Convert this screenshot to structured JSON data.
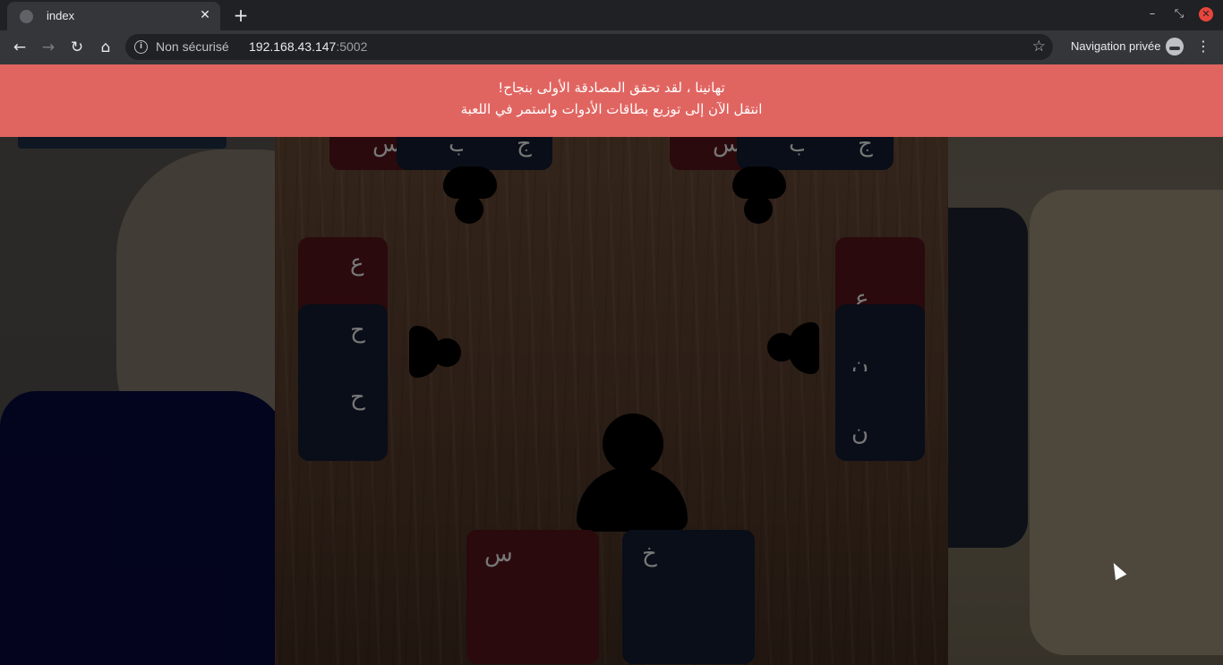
{
  "browser": {
    "tab_title": "index",
    "tab_close_icon": "✕",
    "new_tab_icon": "+",
    "security_label": "Non sécurisé",
    "url_host": "192.168.43.147",
    "url_port": ":5002",
    "incognito_label": "Navigation privée",
    "icons": {
      "back": "back-arrow-icon",
      "forward": "forward-arrow-icon",
      "reload": "reload-icon",
      "home": "home-icon",
      "info": "info-icon",
      "star": "star-icon",
      "incognito": "incognito-icon",
      "menu": "menu-icon"
    }
  },
  "toast": {
    "line1": "تهانينا ، لقد تحقق المصادقة الأولى بنجاح!",
    "line2": "انتقل الآن إلى توزيع بطاقات الأدوات واستمر في اللعبة",
    "color": "#e06561"
  },
  "game": {
    "top_left_hand": [
      "س",
      "ب",
      "ج"
    ],
    "top_right_hand": [
      "س",
      "ب",
      "ج"
    ],
    "left_hand": [
      "ع",
      "ح",
      "ح"
    ],
    "right_hand": [
      "ع",
      "ن",
      "ن"
    ],
    "player_hand": [
      "س",
      "خ"
    ],
    "card_colors": {
      "red": "#3b0f12",
      "blue": "#0d1422"
    }
  }
}
